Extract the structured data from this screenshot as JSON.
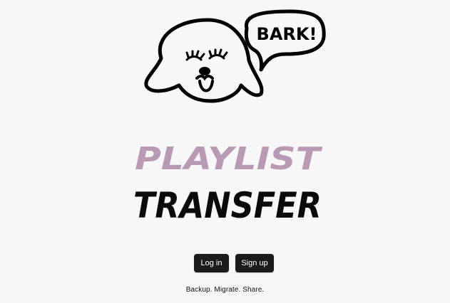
{
  "mascot": {
    "speech_text": "BARK!",
    "icon": "dog-mascot-icon"
  },
  "title": {
    "line1": "PLAYLIST",
    "line2": "TRANSFER",
    "line1_color": "#b89ab5",
    "line2_color": "#0a0a0a"
  },
  "auth": {
    "login_label": "Log in",
    "signup_label": "Sign up"
  },
  "tagline": "Backup. Migrate. Share.",
  "colors": {
    "background": "#f8f8f8",
    "button_bg": "#1b1b1b",
    "button_text": "#ffffff"
  }
}
